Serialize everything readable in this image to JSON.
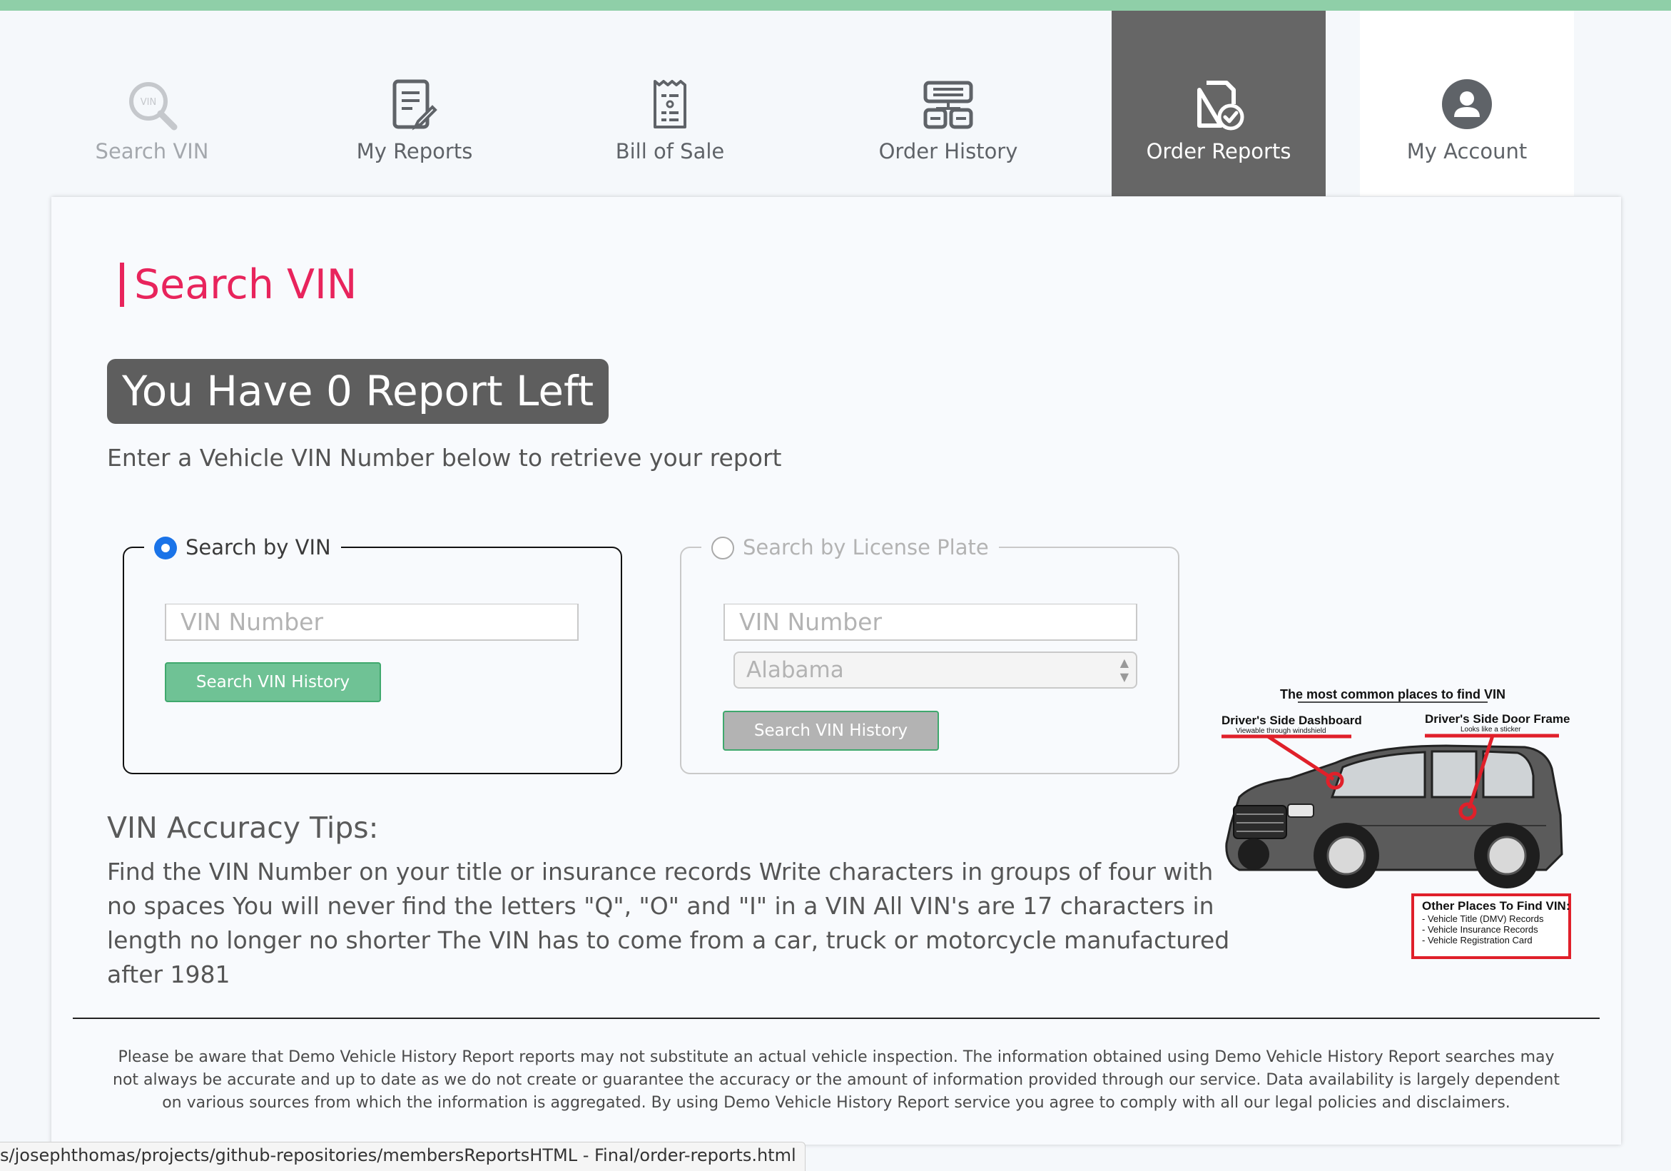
{
  "nav": {
    "items": [
      {
        "label": "Search VIN",
        "icon": "search-vin-icon"
      },
      {
        "label": "My Reports",
        "icon": "report-edit-icon"
      },
      {
        "label": "Bill of Sale",
        "icon": "receipt-icon"
      },
      {
        "label": "Order History",
        "icon": "order-history-icon"
      },
      {
        "label": "Order Reports",
        "icon": "order-reports-icon"
      },
      {
        "label": "My Account",
        "icon": "user-avatar-icon"
      }
    ],
    "active_item": "Order Reports"
  },
  "page": {
    "title": "Search VIN",
    "reports_left": "You Have 0 Report Left",
    "instructions": "Enter a Vehicle VIN Number below to retrieve your report"
  },
  "search_vin": {
    "legend": "Search by VIN",
    "selected": true,
    "input_placeholder": "VIN Number",
    "button_label": "Search VIN History"
  },
  "search_plate": {
    "legend": "Search by License Plate",
    "selected": false,
    "input_placeholder": "VIN Number",
    "state_value": "Alabama",
    "button_label": "Search VIN History"
  },
  "tips": {
    "title": "VIN Accuracy Tips:",
    "text": "Find the VIN Number on your title or insurance records Write characters in groups of four with no spaces You will never find the letters \"Q\", \"O\" and \"I\" in a VIN All VIN's are 17 characters in length no longer no shorter The VIN has to come from a car, truck or motorcycle manufactured after 1981"
  },
  "vin_figure": {
    "title": "The most common places to find VIN",
    "dashboard_label": "Driver's Side Dashboard",
    "dashboard_sub": "Viewable through windshield",
    "door_label": "Driver's Side Door Frame",
    "door_sub": "Looks like a sticker",
    "other_title": "Other Places To Find VIN:",
    "other_items": [
      "- Vehicle Title (DMV) Records",
      "- Vehicle Insurance Records",
      "- Vehicle Registration Card"
    ]
  },
  "disclaimer": "Please be aware that Demo Vehicle History Report reports may not substitute an actual vehicle inspection. The information obtained using Demo Vehicle History Report searches may not always be accurate and up to date as we do not create or guarantee the accuracy or the amount of information provided through our service. Data availability is largely dependent on various sources from which the information is aggregated. By using Demo Vehicle History Report service you agree to comply with all our legal policies and disclaimers.",
  "status_bar": "s/josephthomas/projects/github-repositories/membersReportsHTML - Final/order-reports.html",
  "colors": {
    "accent_pink": "#e8245c",
    "active_tab": "#666666",
    "button_green": "#6fc295",
    "radio_blue": "#1a73e8",
    "top_bar": "#8fcfa8",
    "figure_red": "#e0202a"
  }
}
